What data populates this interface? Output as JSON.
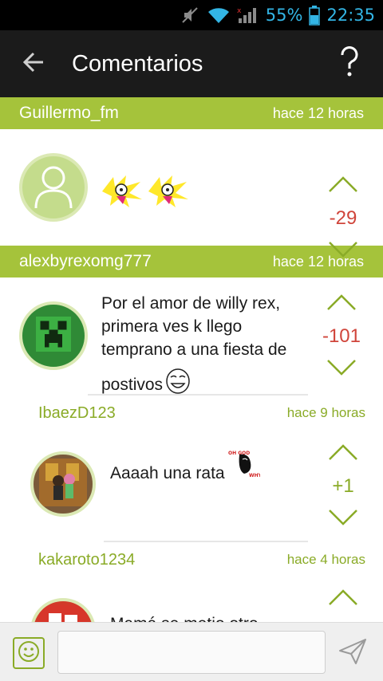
{
  "status_bar": {
    "battery": "55%",
    "time": "22:35"
  },
  "header": {
    "title": "Comentarios"
  },
  "comments": [
    {
      "username": "Guillermo_fm",
      "time": "hace 12 horas",
      "text": "",
      "score": "-29",
      "avatar": "default-user-icon"
    },
    {
      "username": "alexbyrexomg777",
      "time": "hace 12 horas",
      "text_lines": [
        "Por el amor de willy rex,",
        "primera ves k llego",
        "temprano a una fiesta de",
        "postivos"
      ],
      "score": "-101",
      "avatar": "creeper-avatar"
    },
    {
      "username": "IbaezD123",
      "time": "hace 9 horas",
      "text": "Aaaah una rata",
      "score": "+1",
      "avatar": "anime-couple-avatar"
    },
    {
      "username": "kakaroto1234",
      "time": "hace 4 horas",
      "text": "Mamá se metio otro",
      "score": "",
      "avatar": "red-comic-avatar"
    }
  ],
  "input": {
    "placeholder": ""
  },
  "colors": {
    "accent": "#a5c33b",
    "negative": "#d0453b",
    "statusbar_icons": "#33b5e5"
  }
}
